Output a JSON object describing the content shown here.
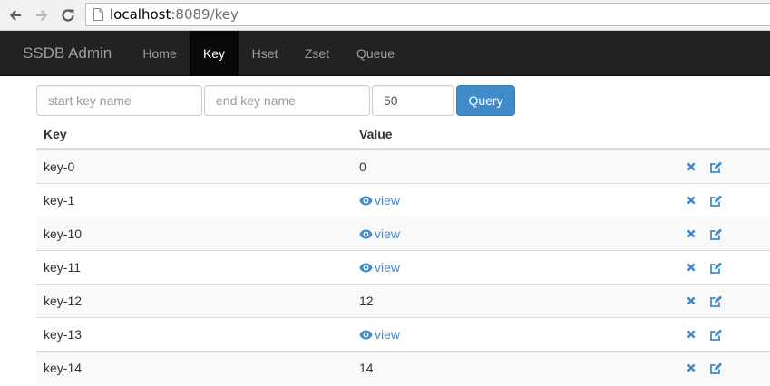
{
  "browser": {
    "url_host": "localhost",
    "url_rest": ":8089/key"
  },
  "navbar": {
    "brand": "SSDB Admin",
    "items": [
      {
        "label": "Home",
        "active": false
      },
      {
        "label": "Key",
        "active": true
      },
      {
        "label": "Hset",
        "active": false
      },
      {
        "label": "Zset",
        "active": false
      },
      {
        "label": "Queue",
        "active": false
      }
    ]
  },
  "query_form": {
    "start_placeholder": "start key name",
    "end_placeholder": "end key name",
    "limit_value": "50",
    "submit_label": "Query"
  },
  "table": {
    "columns": [
      "Key",
      "Value"
    ],
    "rows": [
      {
        "key": "key-0",
        "value": "0",
        "value_type": "text"
      },
      {
        "key": "key-1",
        "value": "view",
        "value_type": "link"
      },
      {
        "key": "key-10",
        "value": "view",
        "value_type": "link"
      },
      {
        "key": "key-11",
        "value": "view",
        "value_type": "link"
      },
      {
        "key": "key-12",
        "value": "12",
        "value_type": "text"
      },
      {
        "key": "key-13",
        "value": "view",
        "value_type": "link"
      },
      {
        "key": "key-14",
        "value": "14",
        "value_type": "text"
      }
    ],
    "row_actions": [
      "delete-icon",
      "edit-icon"
    ]
  },
  "colors": {
    "navbar_bg": "#222222",
    "active_tab_bg": "#080808",
    "primary": "#428bca",
    "stripe": "#f9f9f9"
  }
}
